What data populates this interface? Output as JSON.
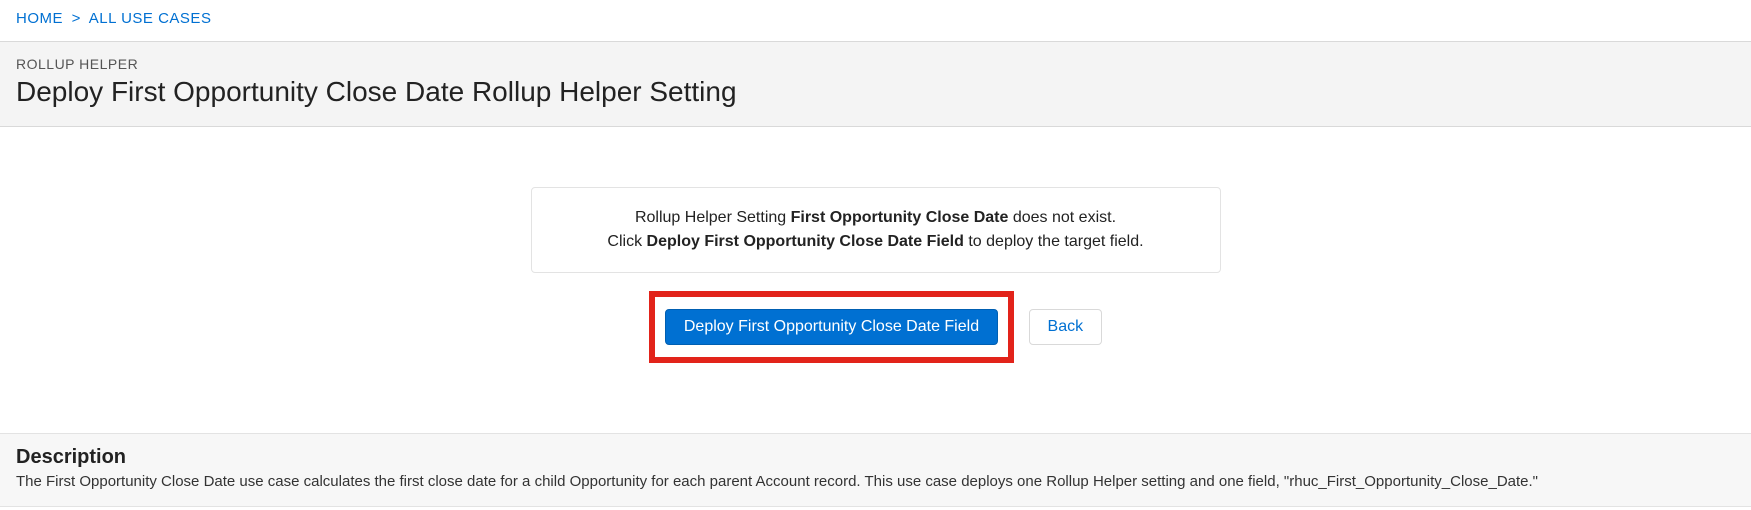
{
  "breadcrumb": {
    "home": "HOME",
    "separator": ">",
    "all_use_cases": "ALL USE CASES"
  },
  "header": {
    "eyebrow": "ROLLUP HELPER",
    "title": "Deploy First Opportunity Close Date Rollup Helper Setting"
  },
  "notice": {
    "line1_pre": "Rollup Helper Setting ",
    "line1_bold": "First Opportunity Close Date",
    "line1_post": " does not exist.",
    "line2_pre": "Click ",
    "line2_bold": "Deploy First Opportunity Close Date Field",
    "line2_post": " to deploy the target field."
  },
  "buttons": {
    "deploy": "Deploy First Opportunity Close Date Field",
    "back": "Back"
  },
  "description": {
    "heading": "Description",
    "body": "The First Opportunity Close Date use case calculates the first close date for a child Opportunity for each parent Account record. This use case deploys one Rollup Helper setting and one field, \"rhuc_First_Opportunity_Close_Date.\""
  }
}
